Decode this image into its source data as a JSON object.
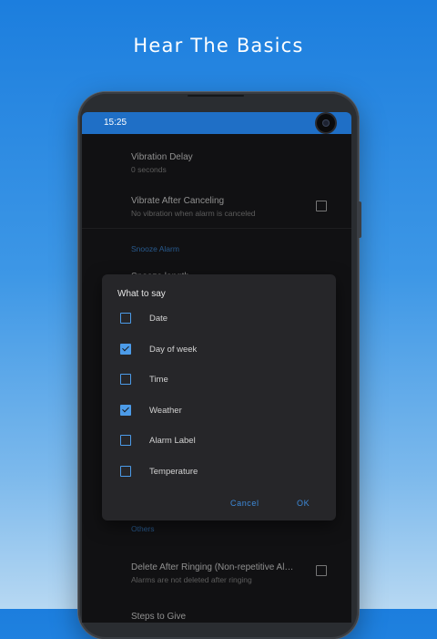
{
  "headline": "Hear The Basics",
  "status_bar": {
    "time": "15:25"
  },
  "settings": {
    "vibration_delay": {
      "title": "Vibration Delay",
      "subtitle": "0 seconds"
    },
    "vibrate_after_canceling": {
      "title": "Vibrate After Canceling",
      "subtitle": "No vibration when alarm is canceled",
      "checked": false
    },
    "snooze_section": "Snooze Alarm",
    "snooze_length_partial": "Snooze length",
    "others_section": "Others",
    "delete_after_ringing": {
      "title": "Delete After Ringing (Non-repetitive Al…",
      "subtitle": "Alarms are not deleted after ringing",
      "checked": false
    },
    "steps_to_give": {
      "title": "Steps to Give"
    }
  },
  "dialog": {
    "title": "What to say",
    "options": [
      {
        "label": "Date",
        "checked": false
      },
      {
        "label": "Day of week",
        "checked": true
      },
      {
        "label": "Time",
        "checked": false
      },
      {
        "label": "Weather",
        "checked": true
      },
      {
        "label": "Alarm Label",
        "checked": false
      },
      {
        "label": "Temperature",
        "checked": false
      }
    ],
    "cancel_label": "Cancel",
    "ok_label": "OK"
  },
  "colors": {
    "accent": "#3d89d8",
    "status_bar": "#1f6fc6",
    "background": "#1b1b1e"
  }
}
